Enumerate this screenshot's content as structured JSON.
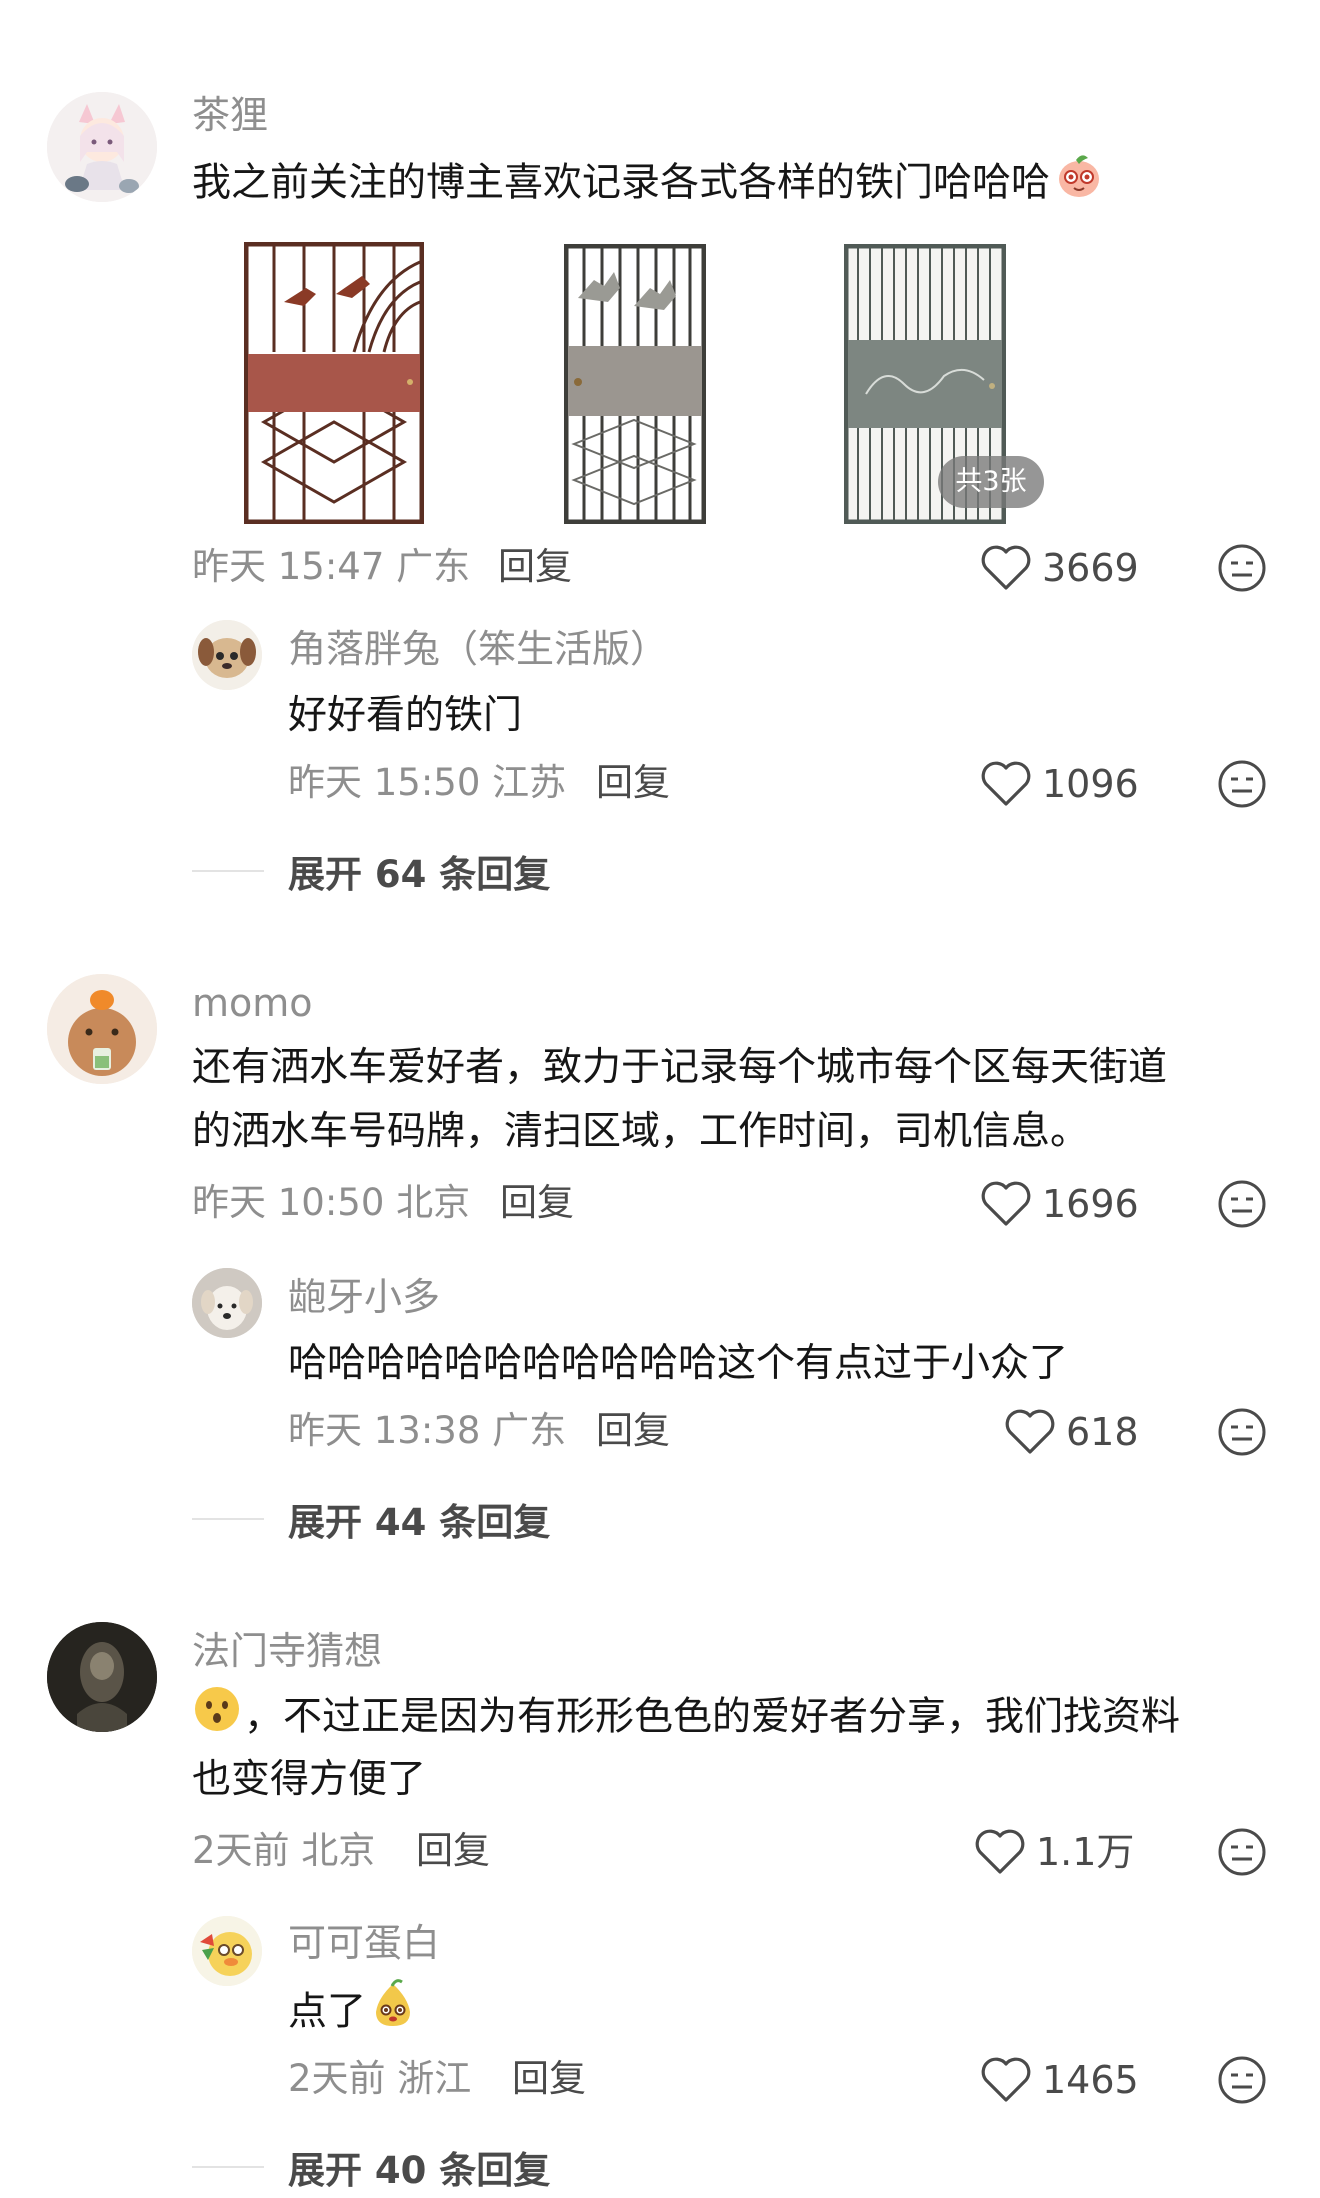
{
  "comments": [
    {
      "author": "茶狸",
      "text": "我之前关注的博主喜欢记录各式各样的铁门哈哈哈",
      "image_count_badge": "共3张",
      "time": "昨天 15:47 广东",
      "reply_label": "回复",
      "likes": "3669",
      "replies": [
        {
          "author": "角落胖兔（笨生活版）",
          "text": "好好看的铁门",
          "time": "昨天 15:50 江苏",
          "reply_label": "回复",
          "likes": "1096"
        }
      ],
      "expand_label": "展开 64 条回复"
    },
    {
      "author": "momo",
      "text_line1": "还有洒水车爱好者，致力于记录每个城市每个区每天街道",
      "text_line2": "的洒水车号码牌，清扫区域，工作时间，司机信息。",
      "time": "昨天 10:50 北京",
      "reply_label": "回复",
      "likes": "1696",
      "replies": [
        {
          "author": "龅牙小多",
          "text": "哈哈哈哈哈哈哈哈哈哈哈这个有点过于小众了",
          "time": "昨天 13:38 广东",
          "reply_label": "回复",
          "likes": "618"
        }
      ],
      "expand_label": "展开 44 条回复"
    },
    {
      "author": "法门寺猜想",
      "text_line1": "，不过正是因为有形形色色的爱好者分享，我们找资料",
      "text_line2": "也变得方便了",
      "time": "2天前 北京",
      "reply_label": "回复",
      "likes": "1.1万",
      "replies": [
        {
          "author": "可可蛋白",
          "text": "点了",
          "time": "2天前 浙江",
          "reply_label": "回复",
          "likes": "1465"
        }
      ],
      "expand_label": "展开 40 条回复"
    }
  ],
  "icons": {
    "like": "heart-outline-icon",
    "dislike": "meh-face-icon"
  },
  "colors": {
    "text_primary": "#161616",
    "text_secondary": "#8e8e8e",
    "action": "#4a4a4a"
  }
}
